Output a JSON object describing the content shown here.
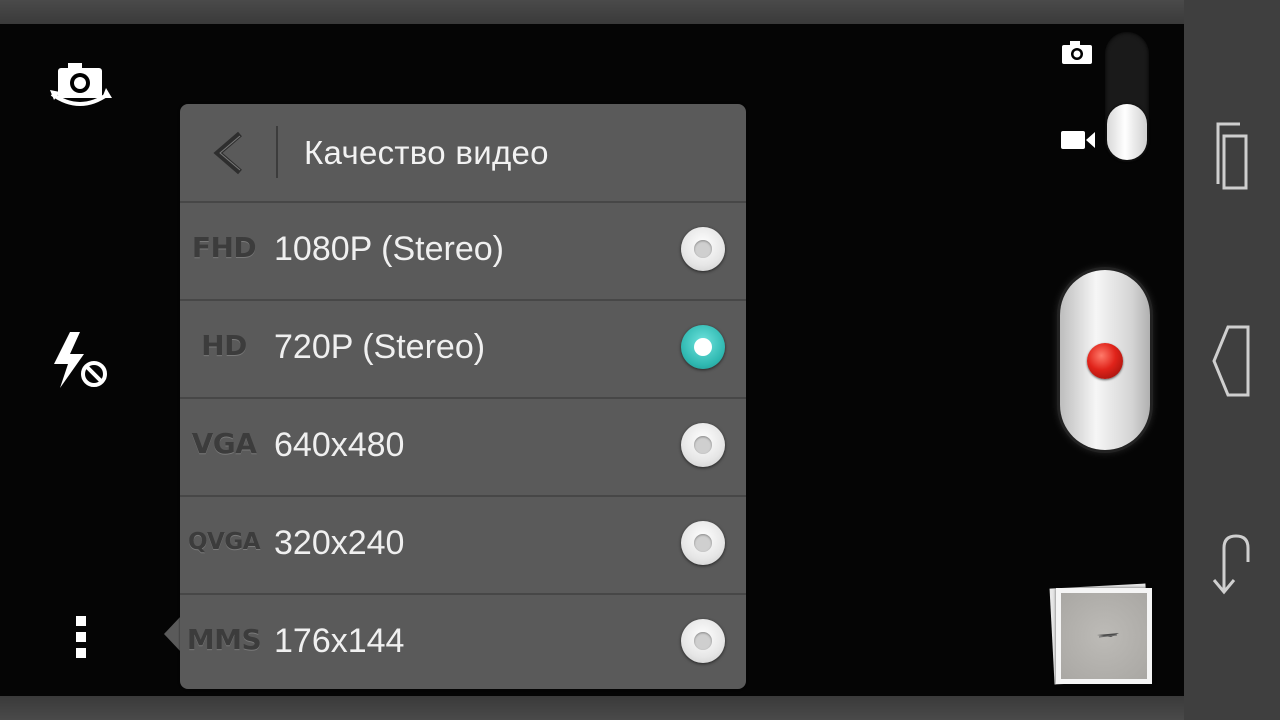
{
  "menu": {
    "title": "Качество видео",
    "options": [
      {
        "tag": "FHD",
        "label": "1080P (Stereo)",
        "selected": false
      },
      {
        "tag": "HD",
        "label": "720P (Stereo)",
        "selected": true
      },
      {
        "tag": "VGA",
        "label": "640x480",
        "selected": false
      },
      {
        "tag": "QVGA",
        "label": "320x240",
        "selected": false
      },
      {
        "tag": "MMS",
        "label": "176x144",
        "selected": false
      }
    ]
  },
  "left_controls": {
    "switch_camera_icon": "camera-switch-icon",
    "flash_icon": "flash-off-icon",
    "more_icon": "more-vertical-icon"
  },
  "right_controls": {
    "mode_photo_icon": "camera-icon",
    "mode_video_icon": "video-camera-icon",
    "selected_mode": "video",
    "record_icon": "record-icon"
  },
  "navbar": {
    "icons": [
      "recent-apps-icon",
      "back-icon",
      "home-icon"
    ]
  },
  "colors": {
    "accent": "#2fb8b1",
    "record": "#e0231a",
    "panel": "#5a5a5a",
    "navbar": "#3f3f3f"
  }
}
